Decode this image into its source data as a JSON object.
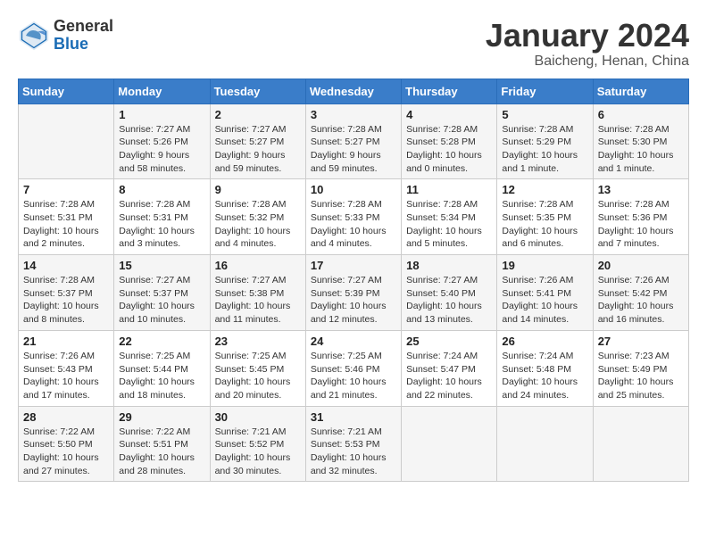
{
  "header": {
    "logo_general": "General",
    "logo_blue": "Blue",
    "title": "January 2024",
    "subtitle": "Baicheng, Henan, China"
  },
  "days_of_week": [
    "Sunday",
    "Monday",
    "Tuesday",
    "Wednesday",
    "Thursday",
    "Friday",
    "Saturday"
  ],
  "weeks": [
    [
      {
        "day": "",
        "info": ""
      },
      {
        "day": "1",
        "info": "Sunrise: 7:27 AM\nSunset: 5:26 PM\nDaylight: 9 hours\nand 58 minutes."
      },
      {
        "day": "2",
        "info": "Sunrise: 7:27 AM\nSunset: 5:27 PM\nDaylight: 9 hours\nand 59 minutes."
      },
      {
        "day": "3",
        "info": "Sunrise: 7:28 AM\nSunset: 5:27 PM\nDaylight: 9 hours\nand 59 minutes."
      },
      {
        "day": "4",
        "info": "Sunrise: 7:28 AM\nSunset: 5:28 PM\nDaylight: 10 hours\nand 0 minutes."
      },
      {
        "day": "5",
        "info": "Sunrise: 7:28 AM\nSunset: 5:29 PM\nDaylight: 10 hours\nand 1 minute."
      },
      {
        "day": "6",
        "info": "Sunrise: 7:28 AM\nSunset: 5:30 PM\nDaylight: 10 hours\nand 1 minute."
      }
    ],
    [
      {
        "day": "7",
        "info": "Sunrise: 7:28 AM\nSunset: 5:31 PM\nDaylight: 10 hours\nand 2 minutes."
      },
      {
        "day": "8",
        "info": "Sunrise: 7:28 AM\nSunset: 5:31 PM\nDaylight: 10 hours\nand 3 minutes."
      },
      {
        "day": "9",
        "info": "Sunrise: 7:28 AM\nSunset: 5:32 PM\nDaylight: 10 hours\nand 4 minutes."
      },
      {
        "day": "10",
        "info": "Sunrise: 7:28 AM\nSunset: 5:33 PM\nDaylight: 10 hours\nand 4 minutes."
      },
      {
        "day": "11",
        "info": "Sunrise: 7:28 AM\nSunset: 5:34 PM\nDaylight: 10 hours\nand 5 minutes."
      },
      {
        "day": "12",
        "info": "Sunrise: 7:28 AM\nSunset: 5:35 PM\nDaylight: 10 hours\nand 6 minutes."
      },
      {
        "day": "13",
        "info": "Sunrise: 7:28 AM\nSunset: 5:36 PM\nDaylight: 10 hours\nand 7 minutes."
      }
    ],
    [
      {
        "day": "14",
        "info": "Sunrise: 7:28 AM\nSunset: 5:37 PM\nDaylight: 10 hours\nand 8 minutes."
      },
      {
        "day": "15",
        "info": "Sunrise: 7:27 AM\nSunset: 5:37 PM\nDaylight: 10 hours\nand 10 minutes."
      },
      {
        "day": "16",
        "info": "Sunrise: 7:27 AM\nSunset: 5:38 PM\nDaylight: 10 hours\nand 11 minutes."
      },
      {
        "day": "17",
        "info": "Sunrise: 7:27 AM\nSunset: 5:39 PM\nDaylight: 10 hours\nand 12 minutes."
      },
      {
        "day": "18",
        "info": "Sunrise: 7:27 AM\nSunset: 5:40 PM\nDaylight: 10 hours\nand 13 minutes."
      },
      {
        "day": "19",
        "info": "Sunrise: 7:26 AM\nSunset: 5:41 PM\nDaylight: 10 hours\nand 14 minutes."
      },
      {
        "day": "20",
        "info": "Sunrise: 7:26 AM\nSunset: 5:42 PM\nDaylight: 10 hours\nand 16 minutes."
      }
    ],
    [
      {
        "day": "21",
        "info": "Sunrise: 7:26 AM\nSunset: 5:43 PM\nDaylight: 10 hours\nand 17 minutes."
      },
      {
        "day": "22",
        "info": "Sunrise: 7:25 AM\nSunset: 5:44 PM\nDaylight: 10 hours\nand 18 minutes."
      },
      {
        "day": "23",
        "info": "Sunrise: 7:25 AM\nSunset: 5:45 PM\nDaylight: 10 hours\nand 20 minutes."
      },
      {
        "day": "24",
        "info": "Sunrise: 7:25 AM\nSunset: 5:46 PM\nDaylight: 10 hours\nand 21 minutes."
      },
      {
        "day": "25",
        "info": "Sunrise: 7:24 AM\nSunset: 5:47 PM\nDaylight: 10 hours\nand 22 minutes."
      },
      {
        "day": "26",
        "info": "Sunrise: 7:24 AM\nSunset: 5:48 PM\nDaylight: 10 hours\nand 24 minutes."
      },
      {
        "day": "27",
        "info": "Sunrise: 7:23 AM\nSunset: 5:49 PM\nDaylight: 10 hours\nand 25 minutes."
      }
    ],
    [
      {
        "day": "28",
        "info": "Sunrise: 7:22 AM\nSunset: 5:50 PM\nDaylight: 10 hours\nand 27 minutes."
      },
      {
        "day": "29",
        "info": "Sunrise: 7:22 AM\nSunset: 5:51 PM\nDaylight: 10 hours\nand 28 minutes."
      },
      {
        "day": "30",
        "info": "Sunrise: 7:21 AM\nSunset: 5:52 PM\nDaylight: 10 hours\nand 30 minutes."
      },
      {
        "day": "31",
        "info": "Sunrise: 7:21 AM\nSunset: 5:53 PM\nDaylight: 10 hours\nand 32 minutes."
      },
      {
        "day": "",
        "info": ""
      },
      {
        "day": "",
        "info": ""
      },
      {
        "day": "",
        "info": ""
      }
    ]
  ]
}
